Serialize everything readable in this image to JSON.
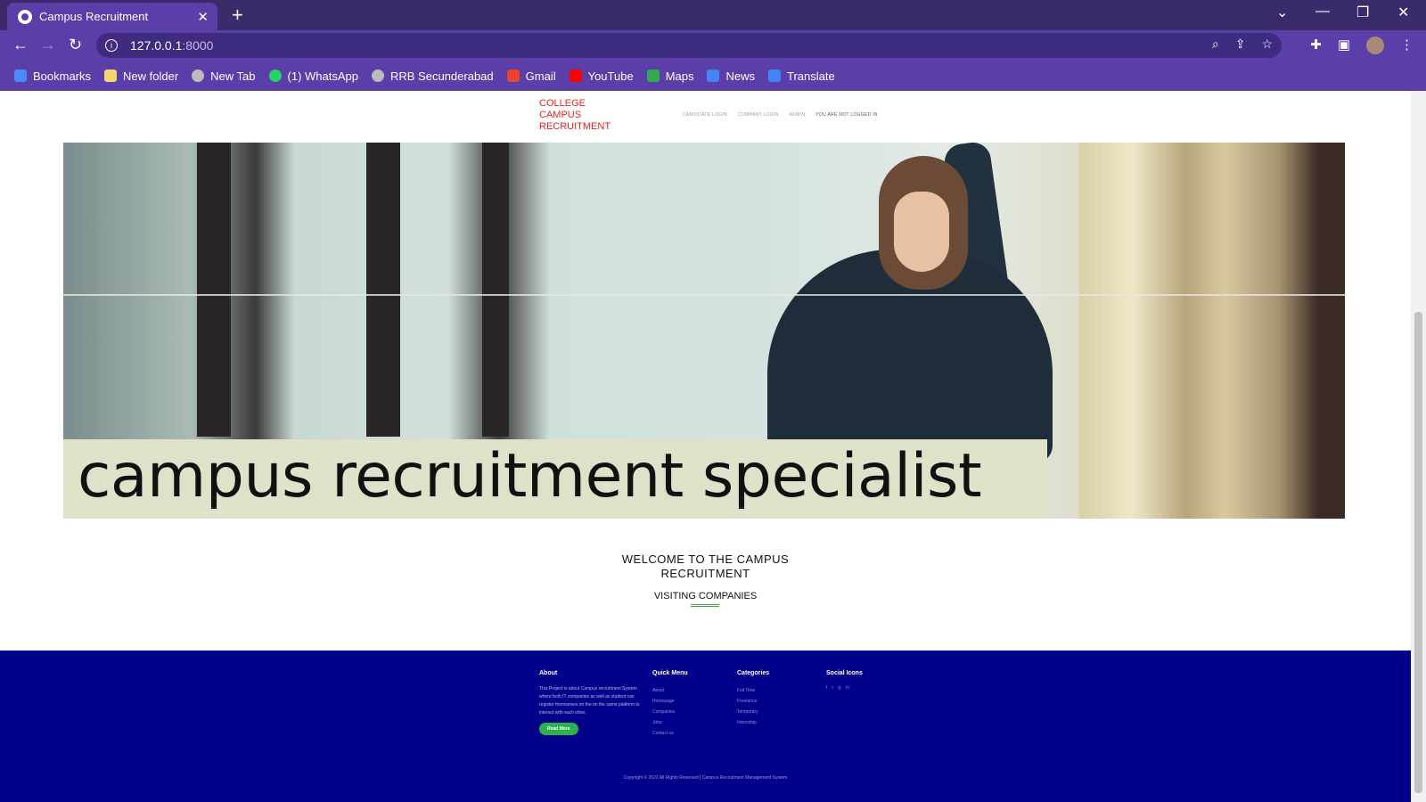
{
  "browser": {
    "tab_title": "Campus Recruitment",
    "url_host": "127.0.0.1",
    "url_port": ":8000",
    "bookmarks": [
      {
        "label": "Bookmarks",
        "icon": "star-icon",
        "color": "#4b8bf5"
      },
      {
        "label": "New folder",
        "icon": "folder-icon",
        "color": "#f5d76e"
      },
      {
        "label": "New Tab",
        "icon": "globe-icon",
        "color": "#bbbbbb"
      },
      {
        "label": "(1) WhatsApp",
        "icon": "whatsapp-icon",
        "color": "#25d366"
      },
      {
        "label": "RRB Secunderabad",
        "icon": "globe-icon",
        "color": "#bbbbbb"
      },
      {
        "label": "Gmail",
        "icon": "gmail-icon",
        "color": "#ea4335"
      },
      {
        "label": "YouTube",
        "icon": "youtube-icon",
        "color": "#ff0000"
      },
      {
        "label": "Maps",
        "icon": "maps-icon",
        "color": "#34a853"
      },
      {
        "label": "News",
        "icon": "news-icon",
        "color": "#4285f4"
      },
      {
        "label": "Translate",
        "icon": "translate-icon",
        "color": "#4285f4"
      }
    ]
  },
  "site": {
    "logo": "COLLEGE\nCAMPUS\nRECRUITMENT",
    "nav": {
      "candidate_login": "CANDIDATE LOGIN",
      "company_login": "COMPANY LOGIN",
      "admin": "ADMIN",
      "status": "YOU ARE NOT LOGGED IN"
    },
    "hero_caption": "campus recruitment specialist",
    "welcome": "WELCOME TO THE CAMPUS\nRECRUITMENT",
    "visiting": "VISITING COMPANIES",
    "accent_color": "#2bb24c",
    "footer_color": "#00008b"
  },
  "footer": {
    "about": {
      "title": "About",
      "text": "This Project is about Campus recruitment System where both IT companies as well as student can register themselves on the on the same platform to interact with each other.",
      "button": "Read More"
    },
    "quick_menu": {
      "title": "Quick Menu",
      "items": [
        "About",
        "Homepage",
        "Companies",
        "Jobs",
        "Contact us"
      ]
    },
    "categories": {
      "title": "Categories",
      "items": [
        "Full Time",
        "Freelance",
        "Temporary",
        "Internship"
      ]
    },
    "social": {
      "title": "Social Icons",
      "icons": [
        "facebook-icon",
        "twitter-icon",
        "instagram-icon",
        "linkedin-icon"
      ]
    },
    "copyright": "Copyright © 2022 All Rights Reserved | Campus Recruitment Management System"
  }
}
